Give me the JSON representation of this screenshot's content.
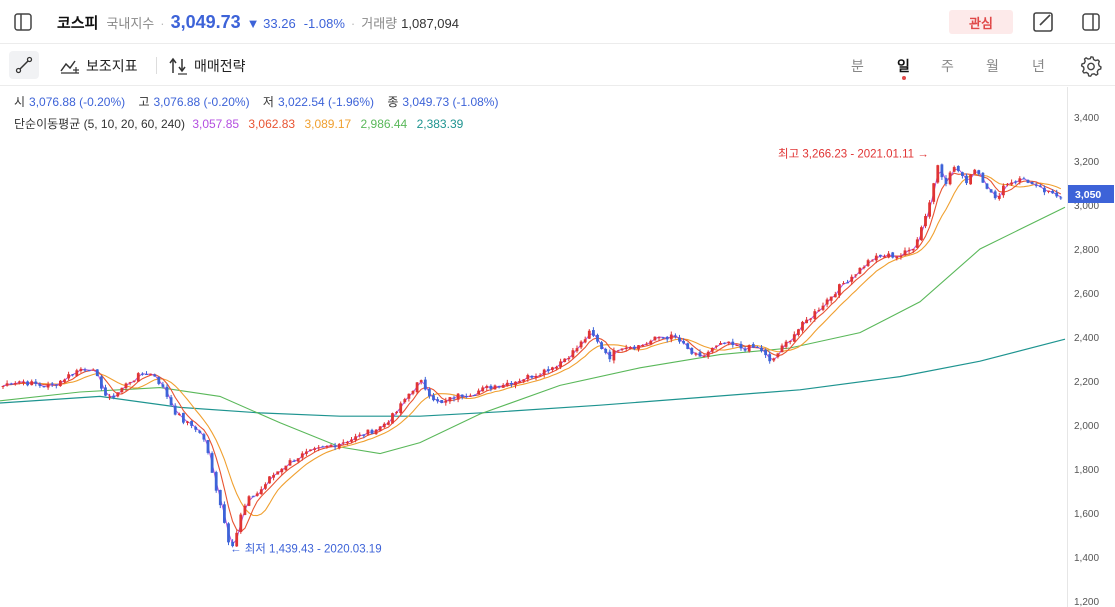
{
  "header": {
    "name": "코스피",
    "market": "국내지수",
    "price": "3,049.73",
    "change": "33.26",
    "change_pct": "-1.08%",
    "volume_label": "거래량",
    "volume": "1,087,094",
    "favorite_label": "관심"
  },
  "toolbar": {
    "indicator_label": "보조지표",
    "strategy_label": "매매전략",
    "periods": [
      "분",
      "일",
      "주",
      "월",
      "년"
    ],
    "active_period": "일"
  },
  "ohlc": {
    "open_label": "시",
    "open": "3,076.88 (-0.20%)",
    "high_label": "고",
    "high": "3,076.88 (-0.20%)",
    "low_label": "저",
    "low": "3,022.54 (-1.96%)",
    "close_label": "종",
    "close": "3,049.73 (-1.08%)"
  },
  "ma": {
    "label": "단순이동평균 (5, 10, 20, 60, 240)",
    "values": [
      "3,057.85",
      "3,062.83",
      "3,089.17",
      "2,986.44",
      "2,383.39"
    ]
  },
  "colors": {
    "up": "#e03434",
    "down": "#3d63d8",
    "ma5": "#b44ee0",
    "ma10": "#e85432",
    "ma20": "#f0a030",
    "ma60": "#5ab85a",
    "ma240": "#1e9490",
    "accent": "#3d63d8",
    "price_tag": "#3d63d8"
  },
  "chart_data": {
    "type": "candlestick",
    "y_ticks": [
      "3,400",
      "3,200",
      "3,000",
      "2,800",
      "2,600",
      "2,400",
      "2,200",
      "2,000",
      "1,800",
      "1,600",
      "1,400",
      "1,200"
    ],
    "ylim": [
      1200,
      3400
    ],
    "current_price_label": "3,050",
    "current_price": 3050,
    "annotations": {
      "high": {
        "text": "최고 3,266.23 - 2021.01.11 →",
        "value": 3266.23
      },
      "low": {
        "text": "← 최저 1,439.43 - 2020.03.19",
        "value": 1439.43
      }
    },
    "close_path": [
      [
        0,
        2170
      ],
      [
        10,
        2195
      ],
      [
        20,
        2200
      ],
      [
        30,
        2190
      ],
      [
        40,
        2180
      ],
      [
        50,
        2175
      ],
      [
        60,
        2200
      ],
      [
        70,
        2230
      ],
      [
        80,
        2255
      ],
      [
        90,
        2262
      ],
      [
        100,
        2190
      ],
      [
        108,
        2110
      ],
      [
        120,
        2160
      ],
      [
        130,
        2200
      ],
      [
        145,
        2240
      ],
      [
        155,
        2225
      ],
      [
        165,
        2150
      ],
      [
        175,
        2060
      ],
      [
        185,
        2010
      ],
      [
        195,
        1990
      ],
      [
        205,
        1930
      ],
      [
        212,
        1780
      ],
      [
        220,
        1650
      ],
      [
        228,
        1480
      ],
      [
        234,
        1457
      ],
      [
        240,
        1580
      ],
      [
        248,
        1660
      ],
      [
        260,
        1700
      ],
      [
        270,
        1760
      ],
      [
        285,
        1820
      ],
      [
        300,
        1860
      ],
      [
        320,
        1890
      ],
      [
        340,
        1920
      ],
      [
        360,
        1950
      ],
      [
        380,
        1990
      ],
      [
        395,
        2050
      ],
      [
        410,
        2150
      ],
      [
        420,
        2200
      ],
      [
        430,
        2140
      ],
      [
        440,
        2090
      ],
      [
        455,
        2130
      ],
      [
        475,
        2150
      ],
      [
        495,
        2180
      ],
      [
        515,
        2200
      ],
      [
        535,
        2230
      ],
      [
        555,
        2270
      ],
      [
        575,
        2340
      ],
      [
        590,
        2420
      ],
      [
        600,
        2360
      ],
      [
        610,
        2310
      ],
      [
        620,
        2360
      ],
      [
        640,
        2360
      ],
      [
        660,
        2400
      ],
      [
        675,
        2400
      ],
      [
        690,
        2330
      ],
      [
        700,
        2300
      ],
      [
        710,
        2340
      ],
      [
        725,
        2370
      ],
      [
        740,
        2350
      ],
      [
        760,
        2350
      ],
      [
        770,
        2280
      ],
      [
        780,
        2340
      ],
      [
        795,
        2420
      ],
      [
        810,
        2490
      ],
      [
        825,
        2560
      ],
      [
        840,
        2630
      ],
      [
        855,
        2690
      ],
      [
        870,
        2750
      ],
      [
        885,
        2770
      ],
      [
        900,
        2770
      ],
      [
        912,
        2800
      ],
      [
        920,
        2880
      ],
      [
        930,
        3020
      ],
      [
        938,
        3190
      ],
      [
        945,
        3100
      ],
      [
        955,
        3180
      ],
      [
        965,
        3100
      ],
      [
        975,
        3170
      ],
      [
        985,
        3100
      ],
      [
        995,
        3020
      ],
      [
        1005,
        3100
      ],
      [
        1015,
        3110
      ],
      [
        1025,
        3120
      ],
      [
        1035,
        3080
      ],
      [
        1045,
        3060
      ],
      [
        1055,
        3040
      ],
      [
        1065,
        3050
      ]
    ],
    "ma240_path": [
      [
        0,
        2100
      ],
      [
        100,
        2130
      ],
      [
        180,
        2080
      ],
      [
        260,
        2055
      ],
      [
        340,
        2040
      ],
      [
        420,
        2040
      ],
      [
        500,
        2060
      ],
      [
        600,
        2090
      ],
      [
        700,
        2125
      ],
      [
        800,
        2160
      ],
      [
        900,
        2220
      ],
      [
        980,
        2290
      ],
      [
        1065,
        2390
      ]
    ],
    "ma60_path": [
      [
        0,
        2110
      ],
      [
        80,
        2150
      ],
      [
        160,
        2170
      ],
      [
        220,
        2130
      ],
      [
        280,
        2010
      ],
      [
        340,
        1900
      ],
      [
        380,
        1870
      ],
      [
        420,
        1920
      ],
      [
        480,
        2050
      ],
      [
        560,
        2180
      ],
      [
        640,
        2260
      ],
      [
        720,
        2320
      ],
      [
        790,
        2350
      ],
      [
        860,
        2420
      ],
      [
        920,
        2560
      ],
      [
        980,
        2800
      ],
      [
        1065,
        2990
      ]
    ]
  }
}
